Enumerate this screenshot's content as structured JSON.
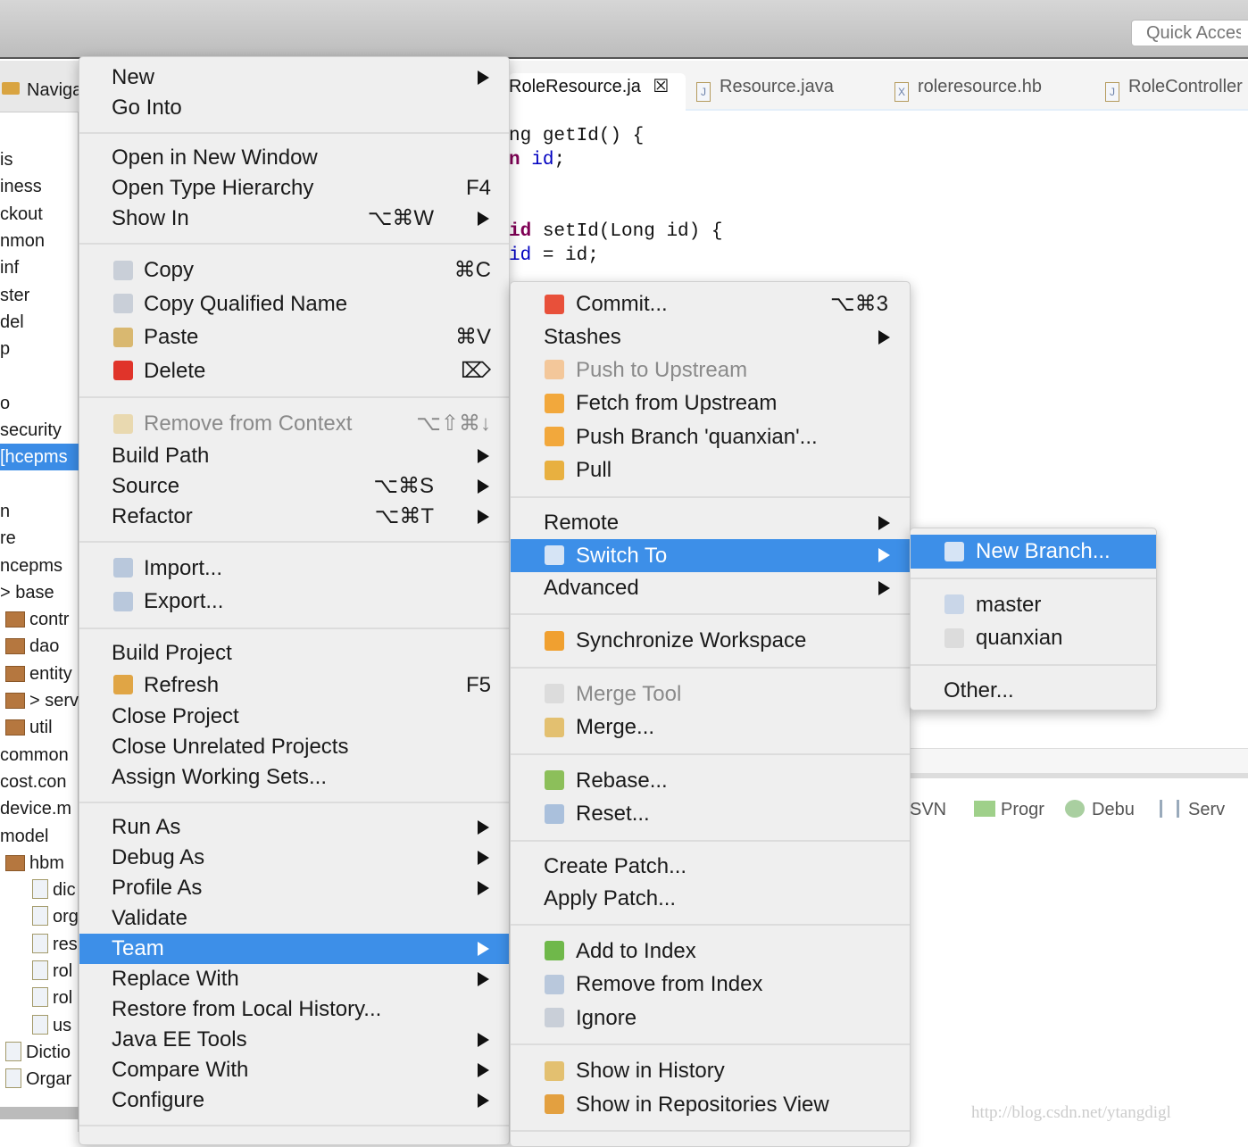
{
  "toolbar": {
    "quick_access_placeholder": "Quick Access"
  },
  "navigator": {
    "tab_label": "Navigator",
    "rows": [
      {
        "t": "is"
      },
      {
        "t": "iness"
      },
      {
        "t": "ckout"
      },
      {
        "t": "nmon"
      },
      {
        "t": "inf"
      },
      {
        "t": "ster"
      },
      {
        "t": "del"
      },
      {
        "t": "p"
      },
      {
        "t": ""
      },
      {
        "t": "o"
      },
      {
        "t": "security"
      },
      {
        "t": " [hcepms",
        "sel": true
      },
      {
        "t": ""
      },
      {
        "t": "n"
      },
      {
        "t": "re"
      },
      {
        "t": "ncepms"
      },
      {
        "t": "> base"
      },
      {
        "t": "contr",
        "icon": "package"
      },
      {
        "t": "dao",
        "icon": "package"
      },
      {
        "t": "entity",
        "icon": "package"
      },
      {
        "t": "> serv",
        "icon": "package"
      },
      {
        "t": "util",
        "icon": "package"
      },
      {
        "t": "common"
      },
      {
        "t": "cost.con"
      },
      {
        "t": "device.m"
      },
      {
        "t": "model"
      },
      {
        "t": "hbm",
        "icon": "package"
      },
      {
        "t": "dic",
        "icon": "xml",
        "indent": true
      },
      {
        "t": "org",
        "icon": "xml",
        "indent": true
      },
      {
        "t": "res",
        "icon": "xml",
        "indent": true
      },
      {
        "t": "rol",
        "icon": "xml",
        "indent": true
      },
      {
        "t": "rol",
        "icon": "xml",
        "indent": true
      },
      {
        "t": "us",
        "icon": "xml",
        "indent": true
      },
      {
        "t": "Dictio",
        "icon": "java"
      },
      {
        "t": "Orgar",
        "icon": "java"
      }
    ]
  },
  "editor": {
    "tabs": [
      {
        "label": "RoleResource.ja",
        "active": true,
        "close": "☒"
      },
      {
        "label": "Resource.java",
        "icon": "J"
      },
      {
        "label": "roleresource.hb",
        "icon": "X"
      },
      {
        "label": "RoleController",
        "icon": "J"
      }
    ],
    "code": [
      {
        "pre": "ng ",
        "kw": "",
        "rest": "getId() {"
      },
      {
        "pre": "",
        "kw": "n",
        "rest": " ",
        "fld": "id",
        ";": ";"
      },
      {
        "pre": "",
        "kw": "id",
        "rest": " setId(Long id) {"
      },
      {
        "pre": "",
        "fld": "id",
        "rest": " = id;"
      }
    ]
  },
  "bottom_tabs": [
    {
      "label": "SVN",
      "icon": ""
    },
    {
      "label": "Progr",
      "icon": "progress-icon"
    },
    {
      "label": "Debu",
      "icon": "bug-icon"
    },
    {
      "label": "Serv",
      "icon": "servers-icon"
    }
  ],
  "watermark": "http://blog.csdn.net/ytangdigl",
  "context_menu": [
    {
      "label": "New",
      "sub": true
    },
    {
      "label": "Go Into"
    },
    {
      "sep": true
    },
    {
      "label": "Open in New Window"
    },
    {
      "label": "Open Type Hierarchy",
      "shortcut": "F4"
    },
    {
      "label": "Show In",
      "shortcut": "⌥⌘W",
      "sub": true
    },
    {
      "sep": true
    },
    {
      "label": "Copy",
      "shortcut": "⌘C",
      "icon": "copy-icon",
      "color": "#c9cfd8"
    },
    {
      "label": "Copy Qualified Name",
      "icon": "copy-qualified-icon",
      "color": "#c9cfd8"
    },
    {
      "label": "Paste",
      "shortcut": "⌘V",
      "icon": "paste-icon",
      "color": "#d9b870"
    },
    {
      "label": "Delete",
      "shortcut": "⌦",
      "icon": "delete-icon",
      "color": "#e0342a"
    },
    {
      "sep": true
    },
    {
      "label": "Remove from Context",
      "shortcut": "⌥⇧⌘↓",
      "icon": "remove-context-icon",
      "color": "#e9d9b0",
      "disabled": true
    },
    {
      "label": "Build Path",
      "sub": true
    },
    {
      "label": "Source",
      "shortcut": "⌥⌘S",
      "sub": true
    },
    {
      "label": "Refactor",
      "shortcut": "⌥⌘T",
      "sub": true
    },
    {
      "sep": true
    },
    {
      "label": "Import...",
      "icon": "import-icon",
      "color": "#b9c8dc"
    },
    {
      "label": "Export...",
      "icon": "export-icon",
      "color": "#b9c8dc"
    },
    {
      "sep": true
    },
    {
      "label": "Build Project"
    },
    {
      "label": "Refresh",
      "shortcut": "F5",
      "icon": "refresh-icon",
      "color": "#e0a545"
    },
    {
      "label": "Close Project"
    },
    {
      "label": "Close Unrelated Projects"
    },
    {
      "label": "Assign Working Sets..."
    },
    {
      "sep": true
    },
    {
      "label": "Run As",
      "sub": true
    },
    {
      "label": "Debug As",
      "sub": true
    },
    {
      "label": "Profile As",
      "sub": true
    },
    {
      "label": "Validate"
    },
    {
      "label": "Team",
      "sub": true,
      "hl": true
    },
    {
      "label": "Replace With",
      "sub": true
    },
    {
      "label": "Restore from Local History..."
    },
    {
      "label": "Java EE Tools",
      "sub": true
    },
    {
      "label": "Compare With",
      "sub": true
    },
    {
      "label": "Configure",
      "sub": true
    },
    {
      "sep": true
    }
  ],
  "team_menu": [
    {
      "label": "Commit...",
      "shortcut": "⌥⌘3",
      "icon": "commit-icon",
      "color": "#e8503a"
    },
    {
      "label": "Stashes",
      "sub": true
    },
    {
      "label": "Push to Upstream",
      "icon": "push-icon",
      "color": "#f3c79a",
      "disabled": true
    },
    {
      "label": "Fetch from Upstream",
      "icon": "fetch-icon",
      "color": "#f2a83c"
    },
    {
      "label": "Push Branch 'quanxian'...",
      "icon": "push-branch-icon",
      "color": "#f2a83c"
    },
    {
      "label": "Pull",
      "icon": "pull-icon",
      "color": "#e8b040"
    },
    {
      "sep": true
    },
    {
      "label": "Remote",
      "sub": true
    },
    {
      "label": "Switch To",
      "sub": true,
      "hl": true,
      "icon": "branch-icon",
      "color": "#d6e4f5"
    },
    {
      "label": "Advanced",
      "sub": true
    },
    {
      "sep": true
    },
    {
      "label": "Synchronize Workspace",
      "icon": "synchronize-icon",
      "color": "#f0a030"
    },
    {
      "sep": true
    },
    {
      "label": "Merge Tool",
      "icon": "merge-tool-icon",
      "color": "#dcdcdc",
      "disabled": true
    },
    {
      "label": "Merge...",
      "icon": "merge-icon",
      "color": "#e3c070"
    },
    {
      "sep": true
    },
    {
      "label": "Rebase...",
      "icon": "rebase-icon",
      "color": "#8cbf5a"
    },
    {
      "label": "Reset...",
      "icon": "reset-icon",
      "color": "#aac0dc"
    },
    {
      "sep": true
    },
    {
      "label": "Create Patch..."
    },
    {
      "label": "Apply Patch..."
    },
    {
      "sep": true
    },
    {
      "label": "Add to Index",
      "icon": "add-icon",
      "color": "#6fb84a"
    },
    {
      "label": "Remove from Index",
      "icon": "remove-index-icon",
      "color": "#b9c8dc"
    },
    {
      "label": "Ignore",
      "icon": "ignore-icon",
      "color": "#c9cfd8"
    },
    {
      "sep": true
    },
    {
      "label": "Show in History",
      "icon": "history-icon",
      "color": "#e3c070"
    },
    {
      "label": "Show in Repositories View",
      "icon": "git-repo-icon",
      "color": "#e3a040"
    },
    {
      "sep": true
    }
  ],
  "switch_menu": [
    {
      "label": "New Branch...",
      "hl": true,
      "icon": "new-branch-icon",
      "color": "#d6e4f5"
    },
    {
      "sep": true
    },
    {
      "label": "master",
      "icon": "branch-icon",
      "color": "#c9d6e8"
    },
    {
      "label": "quanxian",
      "icon": "branch-checked-icon",
      "color": "#dcdcdc"
    },
    {
      "sep": true
    },
    {
      "label": "Other..."
    }
  ]
}
